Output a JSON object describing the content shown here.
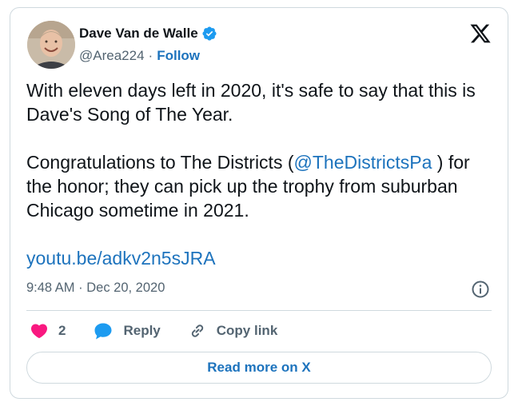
{
  "author": {
    "name": "Dave Van de Walle",
    "handle": "@Area224",
    "follow_label": "Follow",
    "verified_color": "#1d9bf0"
  },
  "post": {
    "line1": "With eleven days left in 2020, it's safe to say that this is Dave's Song of The Year.",
    "line2_prefix": "Congratulations to The Districts (",
    "mention": "@TheDistrictsPa",
    "line2_suffix": " ) for the honor; they can pick up the trophy from suburban Chicago sometime in 2021.",
    "url": "youtu.be/adkv2n5sJRA"
  },
  "meta": {
    "time": "9:48 AM",
    "separator": "·",
    "date": "Dec 20, 2020"
  },
  "actions": {
    "like_count": "2",
    "reply_label": "Reply",
    "copy_label": "Copy link"
  },
  "read_more": "Read more on X",
  "colors": {
    "like": "#f91880",
    "reply": "#1d9bf0",
    "link": "#1d73bd",
    "muted": "#536471"
  },
  "icons": [
    "x-logo-icon",
    "verified-badge-icon",
    "info-icon",
    "heart-icon",
    "reply-bubble-icon",
    "link-icon"
  ]
}
